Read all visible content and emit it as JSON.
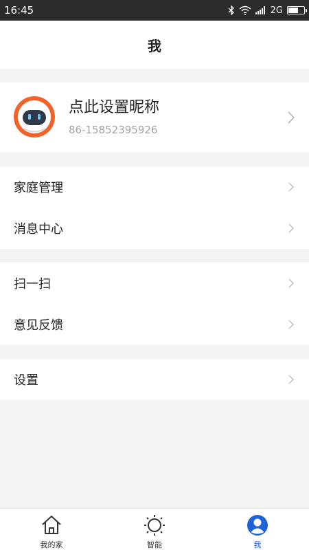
{
  "status_bar": {
    "time": "16:45",
    "network": "2G",
    "icons": [
      "bluetooth-icon",
      "wifi-icon",
      "signal-icon",
      "battery-icon"
    ],
    "battery_level": 0.6
  },
  "header": {
    "title": "我"
  },
  "profile": {
    "nickname": "点此设置昵称",
    "phone": "86-15852395926",
    "avatar_icon": "robot-avatar-icon"
  },
  "menu": {
    "group1": [
      {
        "label": "家庭管理"
      },
      {
        "label": "消息中心"
      }
    ],
    "group2": [
      {
        "label": "扫一扫"
      },
      {
        "label": "意见反馈"
      }
    ],
    "group3": [
      {
        "label": "设置"
      }
    ]
  },
  "tabs": [
    {
      "label": "我的家",
      "icon": "home-icon",
      "active": false
    },
    {
      "label": "智能",
      "icon": "sun-icon",
      "active": false
    },
    {
      "label": "我",
      "icon": "user-icon",
      "active": true
    }
  ],
  "colors": {
    "accent": "#1e62d6",
    "avatar_orange": "#f2622b",
    "background": "#f4f4f4"
  }
}
